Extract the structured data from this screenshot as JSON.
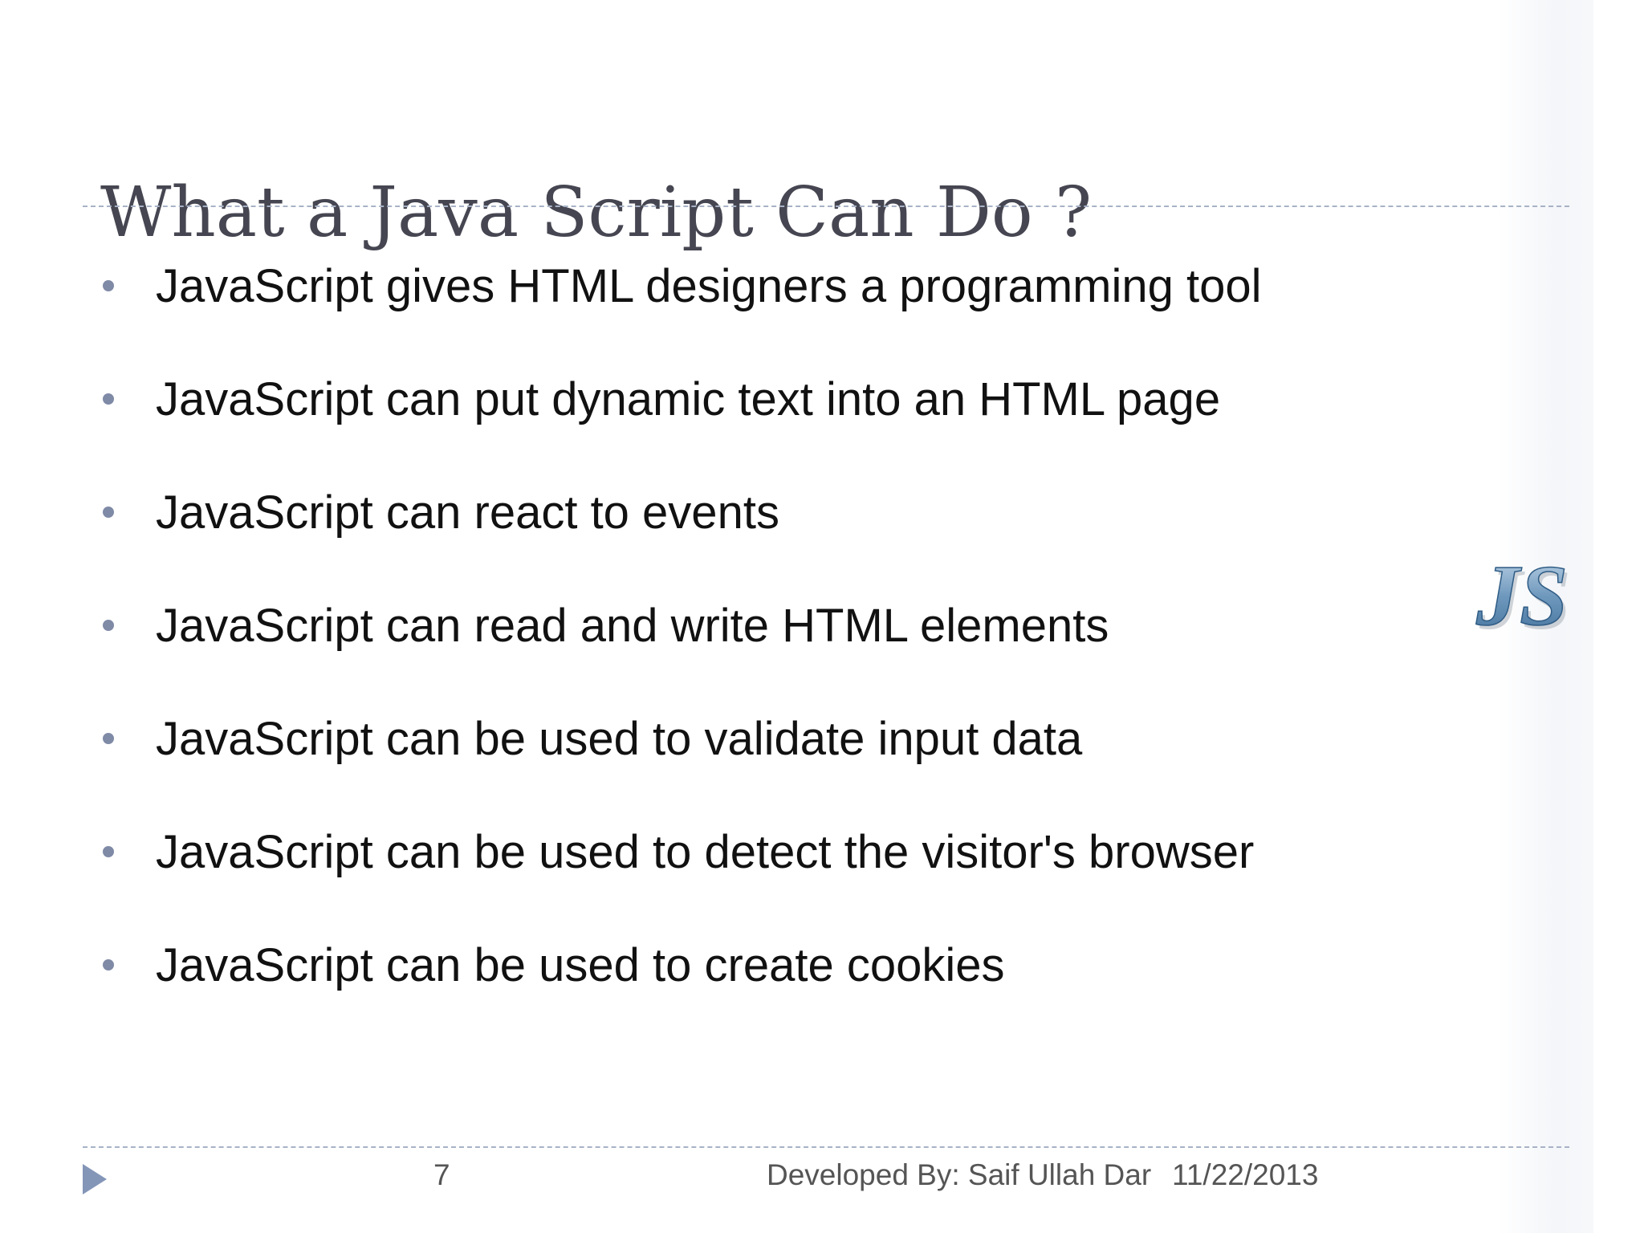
{
  "slide": {
    "title": "What a Java Script Can Do ?",
    "bullets": [
      "JavaScript gives HTML designers a programming tool",
      "JavaScript can put dynamic text into an HTML page",
      "JavaScript can react to events",
      "JavaScript can read and write HTML elements",
      "JavaScript can be used to validate input data",
      "JavaScript can be used to detect the visitor's browser",
      "JavaScript can be used to create cookies"
    ],
    "logo_text": "JS",
    "footer": {
      "page_number": "7",
      "author": "Developed By: Saif Ullah Dar",
      "date": "11/22/2013"
    }
  },
  "colors": {
    "title": "#464652",
    "bullet_dot": "#7f8aa6",
    "body_text": "#111111",
    "rule": "#a8b2c6",
    "footer_arrow": "#8496b8",
    "logo": "#5a86ad"
  },
  "icons": {
    "bullet": "bullet-dot-icon",
    "footer_arrow": "triangle-right-icon",
    "logo": "js-logo-icon"
  }
}
